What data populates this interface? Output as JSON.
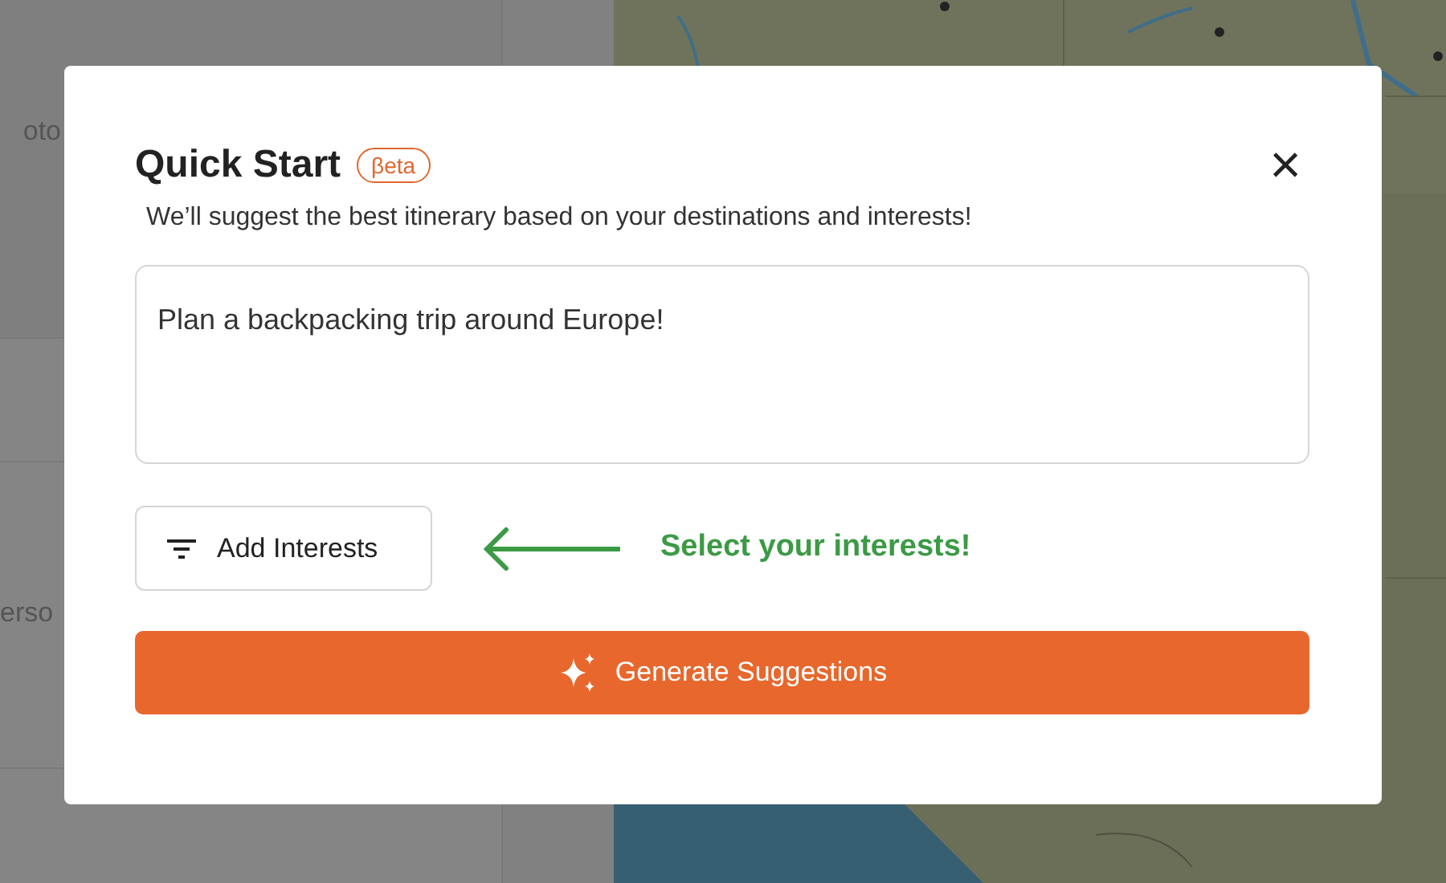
{
  "background": {
    "sidebar_texts": [
      "oto",
      "erso"
    ]
  },
  "dialog": {
    "title": "Quick Start",
    "badge": "βeta",
    "close": "×",
    "subtitle": "We’ll suggest the best itinerary based on your destinations and interests!",
    "prompt": {
      "value": "Plan a backpacking trip around Europe!"
    },
    "interests_button": "Add Interests",
    "hint": "Select your interests!",
    "generate_button": "Generate Suggestions"
  }
}
